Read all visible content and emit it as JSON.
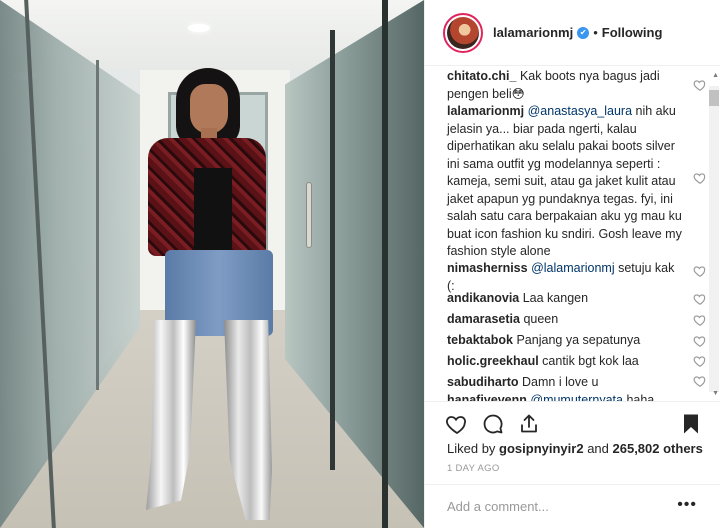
{
  "header": {
    "username": "lalamarionmj",
    "verified_mark": "✔",
    "separator": "•",
    "follow_state": "Following"
  },
  "comments": [
    {
      "user": "chitato.chi_",
      "text": " Kak boots nya bagus jadi pengen beli",
      "emoji": "😳",
      "liked": false
    },
    {
      "user": "lalamarionmj",
      "mention": "@anastasya_laura",
      "text": " nih aku jelasin ya... biar pada ngerti, kalau diperhatikan aku selalu pakai boots silver ini sama outfit yg modelannya seperti : kameja, semi suit, atau ga jaket kulit atau jaket apapun yg pundaknya tegas. fyi, ini salah satu cara berpakaian aku yg mau ku buat icon fashion ku sndiri. Gosh leave my fashion style alone",
      "liked": false
    },
    {
      "user": "nimasherniss",
      "mention": "@lalamarionmj",
      "text": " setuju kak (:",
      "liked": false
    },
    {
      "user": "andikanovia",
      "text": " Laa kangen",
      "liked": false
    },
    {
      "user": "damarasetia",
      "text": " queen",
      "liked": false
    },
    {
      "user": "tebaktabok",
      "text": " Panjang ya sepatunya",
      "liked": false
    },
    {
      "user": "holic.greekhaul",
      "text": " cantik bgt kok laa",
      "liked": false
    },
    {
      "user": "sabudiharto",
      "text": " Damn i love u",
      "liked": false
    },
    {
      "user": "hanafiyevenn",
      "mention": "@mumuternyata",
      "text": " haha",
      "liked": false
    }
  ],
  "actions": {
    "like_icon": "heart-icon",
    "comment_icon": "comment-icon",
    "share_icon": "share-icon",
    "save_icon": "bookmark-icon"
  },
  "likes": {
    "prefix": "Liked by ",
    "user": "gosipnyinyir2",
    "middle": " and ",
    "count": "265,802 others"
  },
  "date": "1 DAY AGO",
  "add_comment": {
    "placeholder": "Add a comment...",
    "value": "",
    "more_label": "•••"
  },
  "colors": {
    "mention": "#003569",
    "verified": "#3897f0",
    "story_ring": "#e0245e"
  }
}
